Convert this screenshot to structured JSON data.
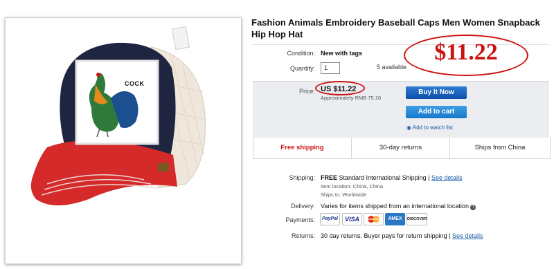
{
  "product": {
    "title": "Fashion Animals Embroidery Baseball Caps Men Women Snapback Hip Hop Hat",
    "patch_text": "COCK"
  },
  "listing": {
    "condition_label": "Condition:",
    "condition_value": "New with tags",
    "quantity_label": "Quantity:",
    "quantity_value": "1",
    "available_text": "5 available",
    "price_label": "Price:",
    "price": "US $11.22",
    "approx_price": "Approximately RMB 75.16",
    "buy_now_label": "Buy It Now",
    "add_to_cart_label": "Add to cart",
    "watch_label": "Add to watch list"
  },
  "annotation": {
    "big_price": "$11.22"
  },
  "perks": [
    "Free shipping",
    "30-day returns",
    "Ships from China"
  ],
  "shipping": {
    "label": "Shipping:",
    "free": "FREE",
    "service": "Standard International Shipping |",
    "details_link": "See details",
    "location_label": "Item location:",
    "location_value": "China, China",
    "ships_to_label": "Ships to:",
    "ships_to_value": "Worldwide"
  },
  "delivery": {
    "label": "Delivery:",
    "text": "Varies for items shipped from an international location"
  },
  "payments": {
    "label": "Payments:",
    "methods": [
      "PayPal",
      "VISA",
      "MasterCard",
      "AMEX",
      "DISCOVER"
    ]
  },
  "returns": {
    "label": "Returns:",
    "text": "30 day returns. Buyer pays for return shipping |",
    "details_link": "See details"
  },
  "colors": {
    "buy_button": "#0b4fa8",
    "cart_button": "#1678c8",
    "link": "#1a5ba6",
    "highlight_red": "#cc1111",
    "free_shipping_red": "#c81414"
  }
}
